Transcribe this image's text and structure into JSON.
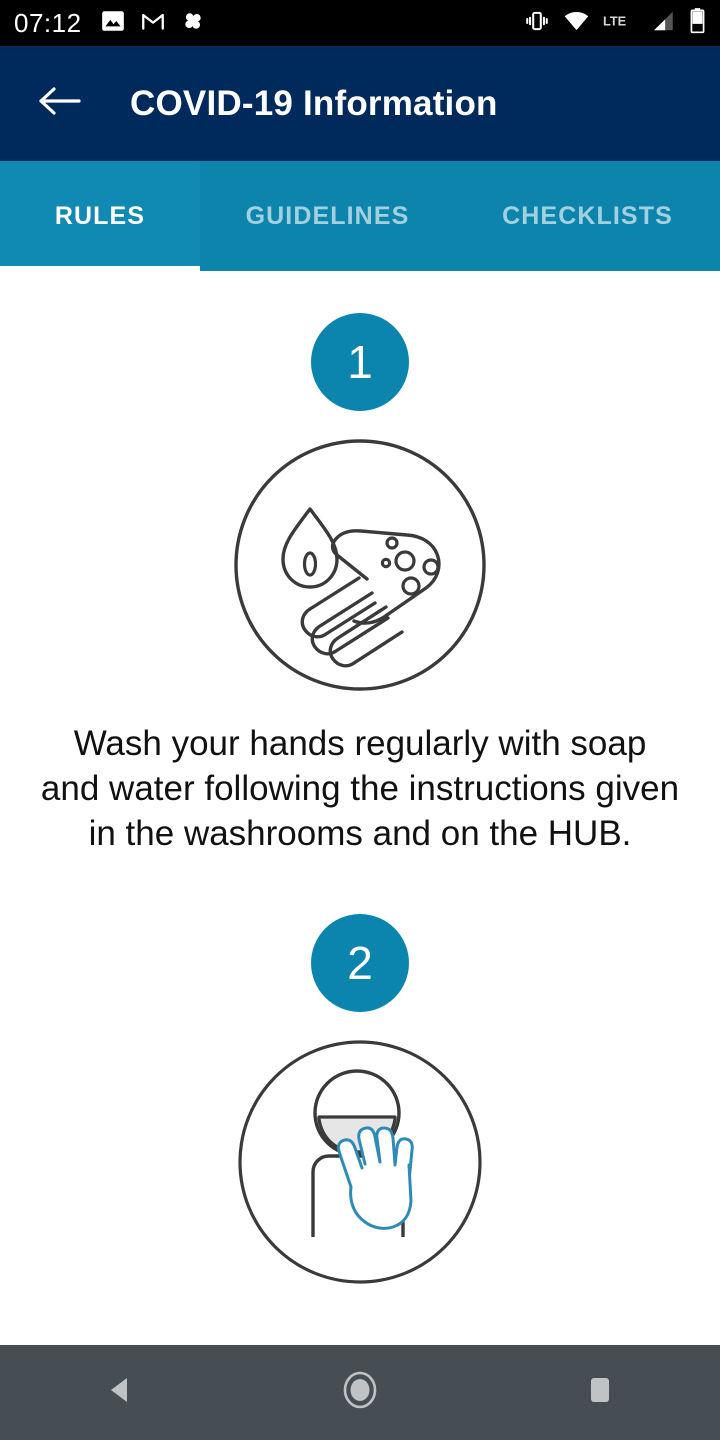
{
  "status_bar": {
    "time": "07:12",
    "left_icons": [
      "photos-icon",
      "gmail-icon",
      "pinwheel-icon"
    ],
    "right_icons": [
      "vibrate-icon",
      "wifi-icon",
      "lte-icon",
      "signal-icon",
      "battery-icon"
    ],
    "network_label": "LTE",
    "background_color": "#000000"
  },
  "app_bar": {
    "back_icon": "back-arrow-icon",
    "title": "COVID-19 Information",
    "background_color": "#002A5C"
  },
  "tabs": {
    "background_color": "#0C84AC",
    "active_index": 0,
    "items": [
      {
        "label": "RULES"
      },
      {
        "label": "GUIDELINES"
      },
      {
        "label": "CHECKLISTS"
      }
    ]
  },
  "rules": [
    {
      "number": "1",
      "icon": "handwashing-icon",
      "text": "Wash your hands regularly with soap and water following the instructions given in the washrooms and on the HUB."
    },
    {
      "number": "2",
      "icon": "do-not-touch-face-icon",
      "text": ""
    }
  ],
  "accent_color": "#0B85AD",
  "nav_bar": {
    "background_color": "#464E54",
    "buttons": [
      {
        "name": "back-triangle-icon"
      },
      {
        "name": "home-circle-icon"
      },
      {
        "name": "recents-square-icon"
      }
    ]
  }
}
